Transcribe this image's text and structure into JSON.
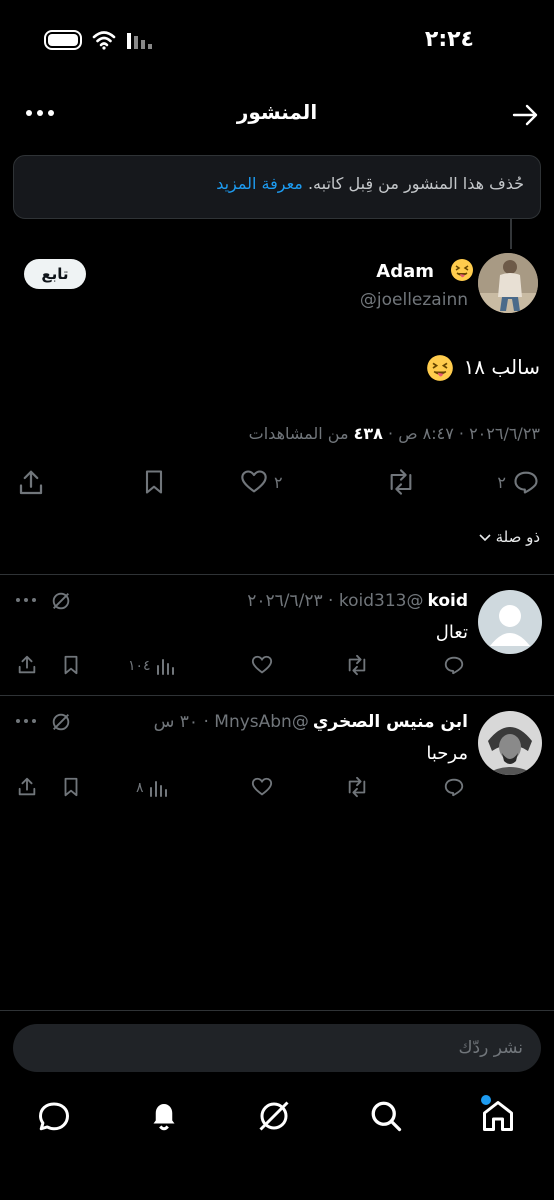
{
  "status_bar": {
    "time": "٢:٢٤"
  },
  "header": {
    "title": "المنشور"
  },
  "notice": {
    "text": "حُذف هذا المنشور من قِبل كاتبه.",
    "link": "معرفة المزيد"
  },
  "post": {
    "author_name": "Adam",
    "author_handle": "@joellezainn",
    "follow_label": "تابع",
    "text": "سالب ١٨",
    "meta_prefix": "٢٠٢٦/٦/٢٣ · ٨:٤٧ ص · ",
    "views_count": "٤٣٨",
    "views_suffix": " من المشاهدات",
    "reply_count": "٢",
    "like_count": "٢"
  },
  "sort": {
    "label": "ذو صلة"
  },
  "replies": [
    {
      "name": "koid",
      "handle_date": "@koid313 · ٢٠٢٦/٦/٢٣",
      "text": "تعال",
      "views": "١٠٤"
    },
    {
      "name": "ابن منيس الصخري",
      "handle_date": "@MnysAbn · ٣٠ س",
      "text": "مرحبا",
      "views": "٨"
    }
  ],
  "composer": {
    "placeholder": "نشر ردّك"
  },
  "colors": {
    "accent": "#1d9bf0",
    "background": "#000000",
    "muted": "#71767b"
  },
  "icons": [
    "back-arrow-icon",
    "more-icon",
    "reply-icon",
    "repost-icon",
    "like-icon",
    "bookmark-icon",
    "share-icon",
    "grok-icon",
    "views-icon",
    "home-icon",
    "search-icon",
    "grok-nav-icon",
    "notifications-icon",
    "messages-icon"
  ]
}
